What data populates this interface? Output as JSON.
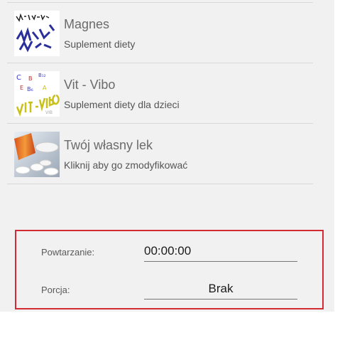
{
  "items": [
    {
      "title": "Magnes",
      "subtitle": "Suplement diety",
      "icon": "magnes-logo"
    },
    {
      "title": "Vit - Vibo",
      "subtitle": "Suplement diety dla dzieci",
      "icon": "vit-vibo-logo"
    },
    {
      "title": "Twój własny lek",
      "subtitle": "Kliknij aby go zmodyfikować",
      "icon": "pills-photo"
    }
  ],
  "settings": {
    "repeat_label": "Powtarzanie:",
    "repeat_value": "00:00:00",
    "portion_label": "Porcja:",
    "portion_value": "Brak"
  },
  "colors": {
    "background": "#f1f1f1",
    "highlight_border": "#d42a33",
    "title_text": "#6b6b6b"
  }
}
